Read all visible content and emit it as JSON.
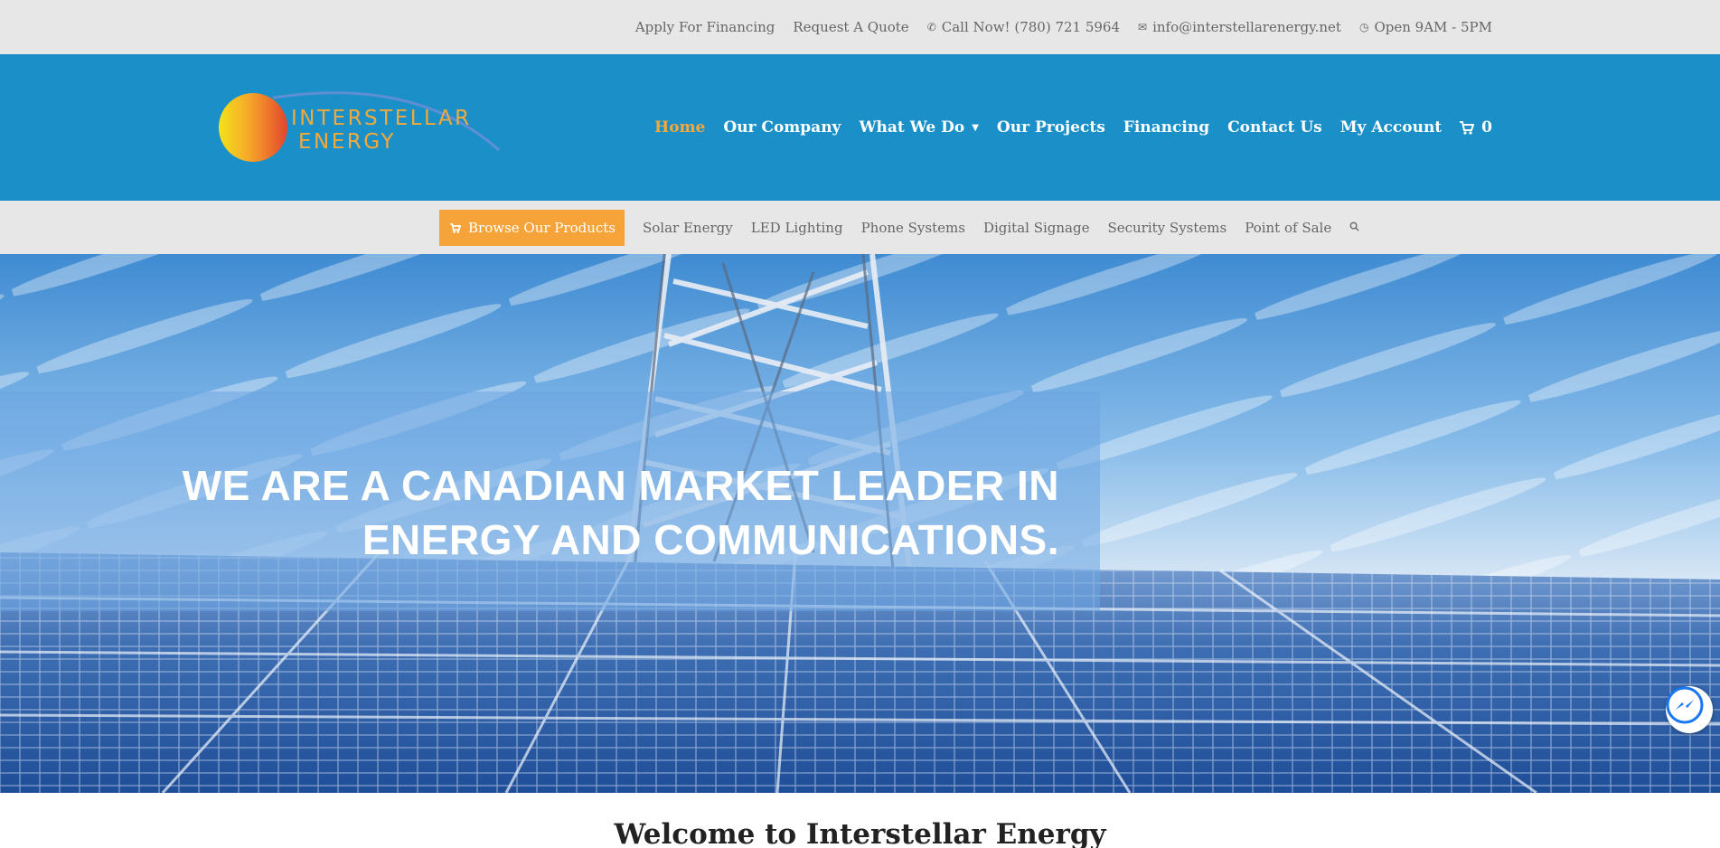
{
  "topbar": {
    "items": [
      {
        "label": "Apply For Financing",
        "icon": ""
      },
      {
        "label": "Request A Quote",
        "icon": ""
      },
      {
        "label": "Call Now! (780) 721 5964",
        "icon": "phone-icon"
      },
      {
        "label": "info@interstellarenergy.net",
        "icon": "mail-icon"
      },
      {
        "label": "Open 9AM - 5PM",
        "icon": "clock-icon"
      }
    ]
  },
  "header": {
    "logo": {
      "line1": "INTERSTELLAR",
      "line2": "ENERGY"
    },
    "nav": [
      {
        "label": "Home",
        "active": true
      },
      {
        "label": "Our Company"
      },
      {
        "label": "What We Do",
        "dropdown": true
      },
      {
        "label": "Our Projects"
      },
      {
        "label": "Financing"
      },
      {
        "label": "Contact Us"
      },
      {
        "label": "My Account"
      }
    ],
    "cart_count": "0"
  },
  "subnav": {
    "browse_label": "Browse Our Products",
    "items": [
      "Solar Energy",
      "LED Lighting",
      "Phone Systems",
      "Digital Signage",
      "Security Systems",
      "Point of Sale"
    ]
  },
  "hero": {
    "line1": "WE ARE A CANADIAN MARKET LEADER IN",
    "line2": "ENERGY AND COMMUNICATIONS."
  },
  "welcome": {
    "title": "Welcome to Interstellar Energy"
  },
  "colors": {
    "header_bg": "#1b90c8",
    "accent": "#f6a43a",
    "topbar_bg": "#e7e7e7"
  }
}
